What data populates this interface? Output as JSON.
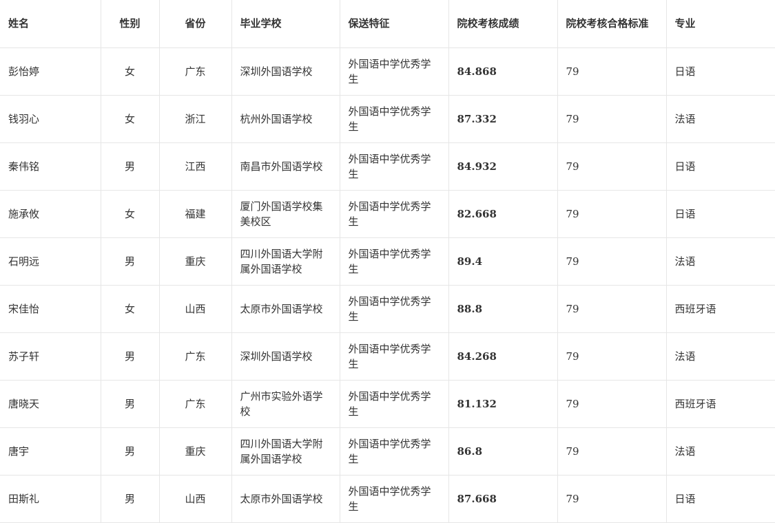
{
  "table": {
    "headers": {
      "name": "姓名",
      "gender": "性别",
      "province": "省份",
      "school": "毕业学校",
      "feature": "保送特征",
      "score": "院校考核成绩",
      "standard": "院校考核合格标准",
      "major": "专业"
    },
    "rows": [
      {
        "name": "彭怡婷",
        "gender": "女",
        "province": "广东",
        "school": "深圳外国语学校",
        "feature": "外国语中学优秀学生",
        "score": "84.868",
        "standard": "79",
        "major": "日语"
      },
      {
        "name": "钱羽心",
        "gender": "女",
        "province": "浙江",
        "school": "杭州外国语学校",
        "feature": "外国语中学优秀学生",
        "score": "87.332",
        "standard": "79",
        "major": "法语"
      },
      {
        "name": "秦伟铭",
        "gender": "男",
        "province": "江西",
        "school": "南昌市外国语学校",
        "feature": "外国语中学优秀学生",
        "score": "84.932",
        "standard": "79",
        "major": "日语"
      },
      {
        "name": "施承攸",
        "gender": "女",
        "province": "福建",
        "school": "厦门外国语学校集美校区",
        "feature": "外国语中学优秀学生",
        "score": "82.668",
        "standard": "79",
        "major": "日语"
      },
      {
        "name": "石明远",
        "gender": "男",
        "province": "重庆",
        "school": "四川外国语大学附属外国语学校",
        "feature": "外国语中学优秀学生",
        "score": "89.4",
        "standard": "79",
        "major": "法语"
      },
      {
        "name": "宋佳怡",
        "gender": "女",
        "province": "山西",
        "school": "太原市外国语学校",
        "feature": "外国语中学优秀学生",
        "score": "88.8",
        "standard": "79",
        "major": "西班牙语"
      },
      {
        "name": "苏子轩",
        "gender": "男",
        "province": "广东",
        "school": "深圳外国语学校",
        "feature": "外国语中学优秀学生",
        "score": "84.268",
        "standard": "79",
        "major": "法语"
      },
      {
        "name": "唐晓天",
        "gender": "男",
        "province": "广东",
        "school": "广州市实验外语学校",
        "feature": "外国语中学优秀学生",
        "score": "81.132",
        "standard": "79",
        "major": "西班牙语"
      },
      {
        "name": "唐宇",
        "gender": "男",
        "province": "重庆",
        "school": "四川外国语大学附属外国语学校",
        "feature": "外国语中学优秀学生",
        "score": "86.8",
        "standard": "79",
        "major": "法语"
      },
      {
        "name": "田斯礼",
        "gender": "男",
        "province": "山西",
        "school": "太原市外国语学校",
        "feature": "外国语中学优秀学生",
        "score": "87.668",
        "standard": "79",
        "major": "日语"
      }
    ]
  }
}
